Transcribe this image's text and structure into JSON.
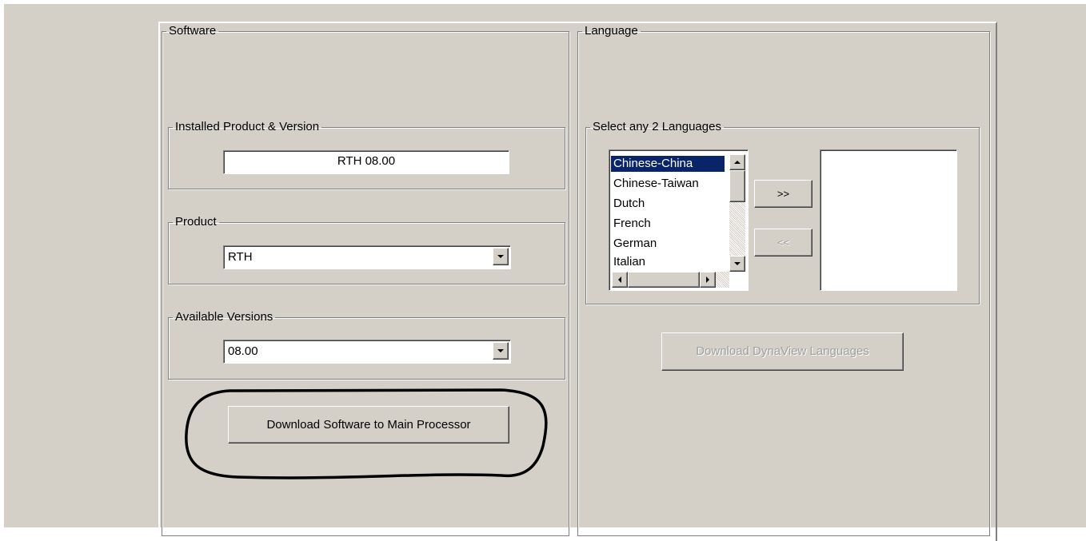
{
  "software": {
    "legend": "Software",
    "installed": {
      "legend": "Installed Product & Version",
      "value": "RTH 08.00"
    },
    "product": {
      "legend": "Product",
      "value": "RTH"
    },
    "versions": {
      "legend": "Available Versions",
      "value": "08.00"
    },
    "download_label": "Download Software to Main Processor"
  },
  "language": {
    "legend": "Language",
    "select": {
      "legend": "Select any 2 Languages",
      "items": [
        "Chinese-China",
        "Chinese-Taiwan",
        "Dutch",
        "French",
        "German",
        "Italian"
      ],
      "selected_index": 0,
      "add_label": ">>",
      "remove_label": "<<"
    },
    "download_label": "Download DynaView Languages"
  },
  "colors": {
    "window_bg": "#d4d0c8",
    "selection": "#0a246a",
    "annotation_stroke": "#000000"
  }
}
